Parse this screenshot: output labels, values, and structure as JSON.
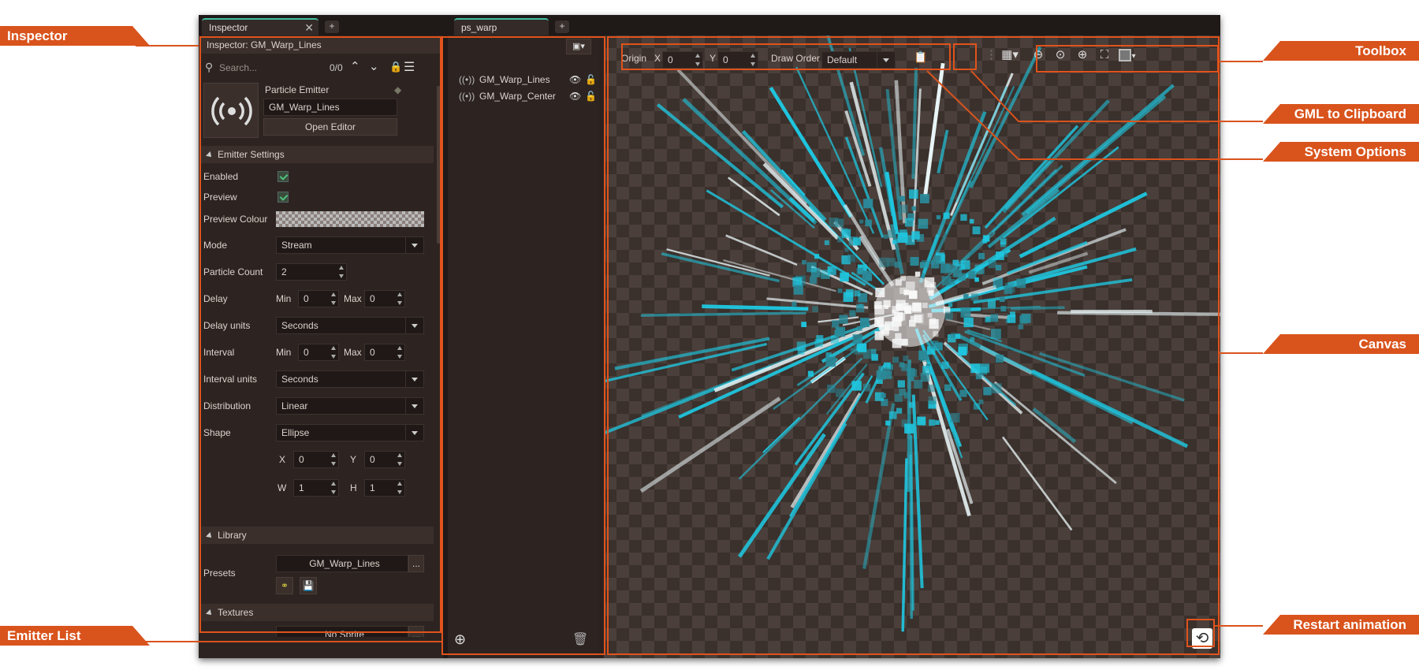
{
  "inspector_tab": {
    "label": "Inspector"
  },
  "editor_tab": {
    "label": "ps_warp"
  },
  "inspector": {
    "title": "Inspector: GM_Warp_Lines",
    "search_placeholder": "Search...",
    "search_count": "0/0",
    "object_type": "Particle Emitter",
    "object_name": "GM_Warp_Lines",
    "open_editor": "Open Editor",
    "sections": {
      "emitter_settings": "Emitter Settings",
      "library": "Library",
      "textures": "Textures"
    },
    "fields": {
      "enabled": "Enabled",
      "preview": "Preview",
      "preview_colour": "Preview Colour",
      "mode_label": "Mode",
      "mode_value": "Stream",
      "particle_count_label": "Particle Count",
      "particle_count_value": "2",
      "delay_label": "Delay",
      "delay_min_label": "Min",
      "delay_min": "0",
      "delay_max_label": "Max",
      "delay_max": "0",
      "delay_units_label": "Delay units",
      "delay_units_value": "Seconds",
      "interval_label": "Interval",
      "interval_min_label": "Min",
      "interval_min": "0",
      "interval_max_label": "Max",
      "interval_max": "0",
      "interval_units_label": "Interval units",
      "interval_units_value": "Seconds",
      "distribution_label": "Distribution",
      "distribution_value": "Linear",
      "shape_label": "Shape",
      "shape_value": "Ellipse",
      "x_label": "X",
      "x_value": "0",
      "y_label": "Y",
      "y_value": "0",
      "w_label": "W",
      "w_value": "1",
      "h_label": "H",
      "h_value": "1",
      "presets_label": "Presets",
      "presets_value": "GM_Warp_Lines",
      "presets_more": "...",
      "texture_value": "No Sprite",
      "texture_more": "..."
    }
  },
  "emitters": [
    {
      "name": "GM_Warp_Lines"
    },
    {
      "name": "GM_Warp_Center"
    }
  ],
  "system_options": {
    "origin_label": "Origin",
    "x_label": "X",
    "x_value": "0",
    "y_label": "Y",
    "y_value": "0",
    "draw_order_label": "Draw Order",
    "draw_order_value": "Default"
  },
  "callouts": {
    "inspector": "Inspector",
    "emitter_list": "Emitter List",
    "toolbox": "Toolbox",
    "gml_to_clipboard": "GML to Clipboard",
    "system_options": "System Options",
    "canvas": "Canvas",
    "restart_animation": "Restart animation"
  },
  "colors": {
    "accent": "#d9531c",
    "particle": "#1fc6df",
    "background": "#2b2220"
  },
  "icons": [
    "search-icon",
    "chevron-up-icon",
    "chevron-down-icon",
    "lock-icon",
    "menu-icon",
    "emitter-icon",
    "eye-icon",
    "add-icon",
    "trash-icon",
    "grid-icon",
    "zoom-out-icon",
    "zoom-reset-icon",
    "zoom-in-icon",
    "fit-icon",
    "background-color-icon",
    "clipboard-icon",
    "restart-icon",
    "link-icon",
    "save-icon"
  ]
}
